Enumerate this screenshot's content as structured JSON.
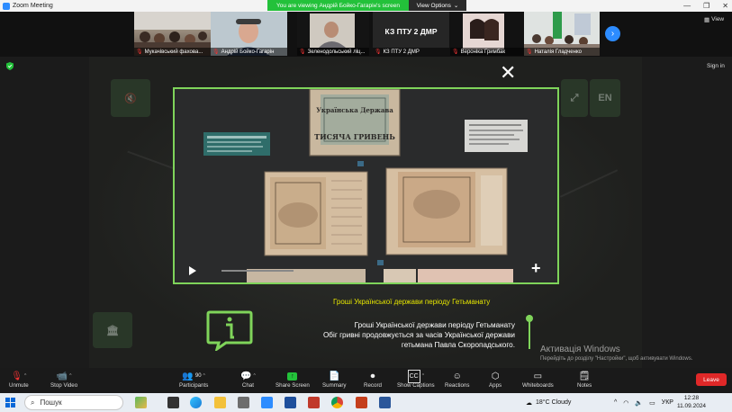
{
  "window": {
    "title": "Zoom Meeting",
    "viewing_banner": "You are viewing Андрій Бойко-Гагарін's screen",
    "view_options_label": "View Options",
    "minimize": "—",
    "restore": "❐",
    "close": "✕"
  },
  "strip": {
    "view_label": "View",
    "thumbs": [
      {
        "name": "Мукачівський фахова..."
      },
      {
        "name": "Андрій Бойко-Гагарін"
      },
      {
        "name": "Зеленодольський ліц..."
      },
      {
        "name": "КЗ ПТУ 2 ДМР",
        "center_text": "КЗ ПТУ 2 ДМР"
      },
      {
        "name": "Вероніка Гримбак"
      },
      {
        "name": "Наталія Гладченко"
      }
    ]
  },
  "shared": {
    "signin_label": "Sign in",
    "lang_label": "EN",
    "headline": "Гроші Української держави періоду Гетьманату",
    "info_lines": [
      "Гроші Української держави періоду Гетьманату",
      "Обіг гривні продовжується за часів Української держави",
      "гетьмана Павла Скоропадського."
    ],
    "banknote_top_text": "Українська Держава",
    "banknote_top_value": "ТИСЯЧА ГРИВЕНЬ"
  },
  "watermark": {
    "title": "Активація Windows",
    "subtitle": "Перейдіть до розділу \"Настройки\", щоб активувати Windows."
  },
  "toolbar": {
    "unmute": "Unmute",
    "stop_video": "Stop Video",
    "participants": "Participants",
    "participants_count": "90",
    "chat": "Chat",
    "share_screen": "Share Screen",
    "summary": "Summary",
    "record": "Record",
    "show_captions": "Show Captions",
    "reactions": "Reactions",
    "apps": "Apps",
    "whiteboards": "Whiteboards",
    "notes": "Notes",
    "leave": "Leave"
  },
  "taskbar": {
    "search_placeholder": "Пошук",
    "weather": "18°C  Cloudy",
    "lang": "УКР",
    "time": "12:28",
    "date": "11.09.2024"
  },
  "colors": {
    "accent_green": "#7fd45a",
    "share_green": "#23c13a",
    "leave_red": "#e02828",
    "zoom_blue": "#2d8cff"
  }
}
